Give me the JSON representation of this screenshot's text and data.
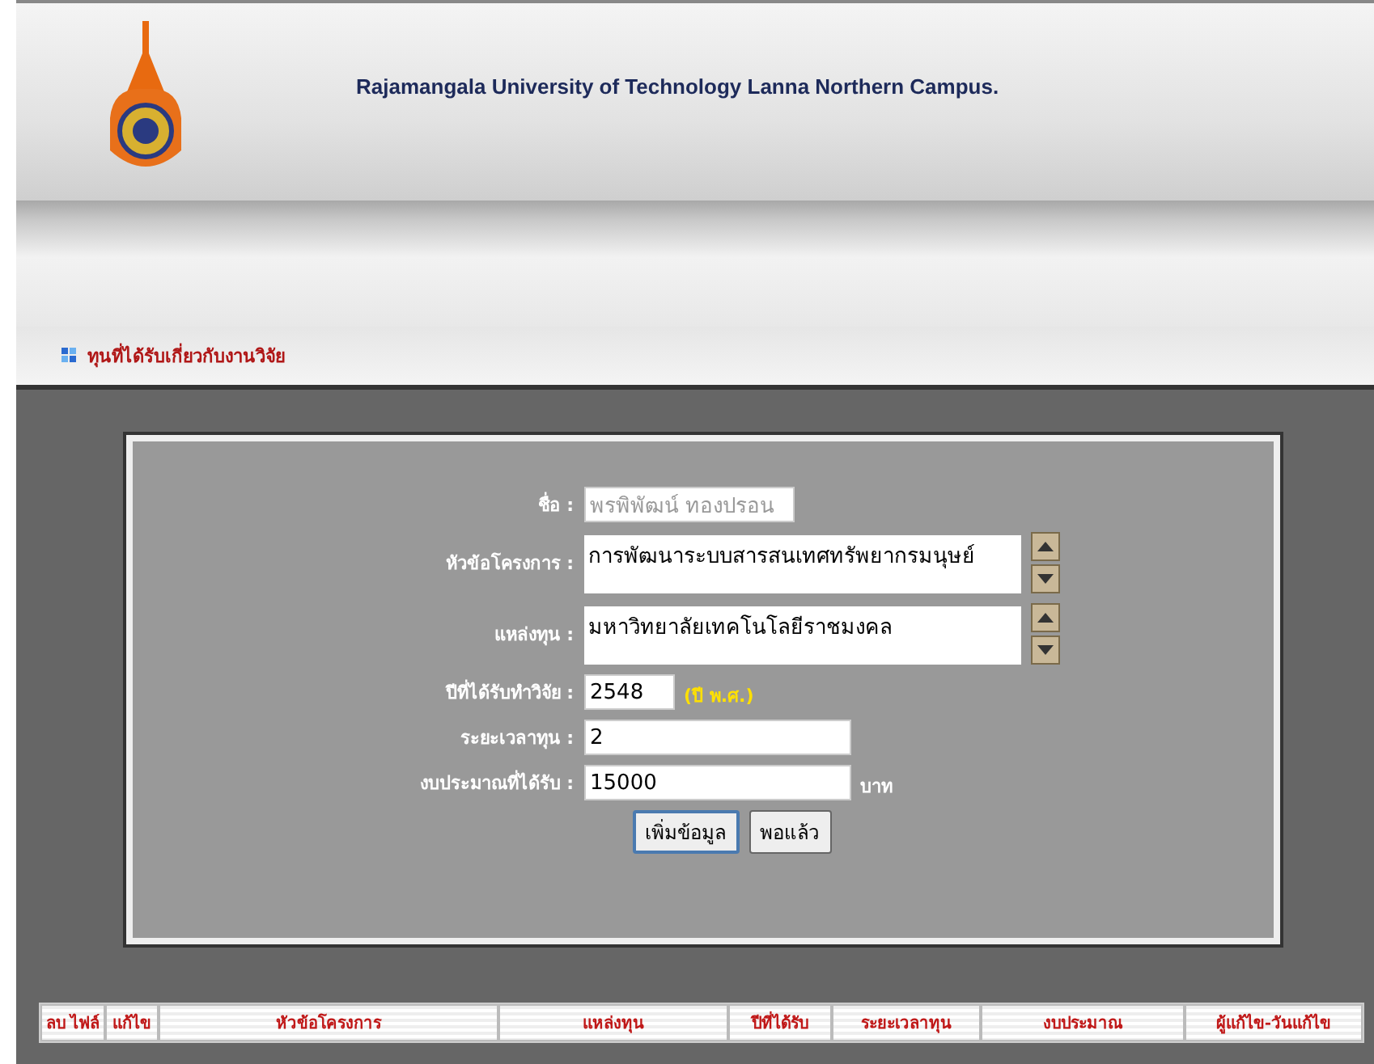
{
  "header": {
    "title": "Rajamangala University of Technology Lanna Northern Campus."
  },
  "section_title": "ทุนที่ได้รับเกี่ยวกับงานวิจัย",
  "form": {
    "fields": [
      {
        "kind": "input",
        "label": "ชื่อ :",
        "value": "พรพิพัฒน์ ทองปรอน",
        "disabled": true
      },
      {
        "kind": "textarea",
        "label": "หัวข้อโครงการ :",
        "value": "การพัฒนาระบบสารสนเทศทรัพยากรมนุษย์"
      },
      {
        "kind": "textarea",
        "label": "แหล่งทุน :",
        "value": "มหาวิทยาลัยเทคโนโลยีราชมงคล"
      },
      {
        "kind": "input",
        "label": "ปีที่ได้รับทำวิจัย :",
        "value": "2548",
        "disabled": false,
        "note": "(ปี พ.ศ.)"
      },
      {
        "kind": "input",
        "label": "ระยะเวลาทุน :",
        "value": "2",
        "disabled": false
      },
      {
        "kind": "input",
        "label": "งบประมาณที่ได้รับ :",
        "value": "15000",
        "disabled": false,
        "suffix": "บาท"
      }
    ],
    "buttons": [
      {
        "label": "เพิ่มข้อมูล",
        "focused": true
      },
      {
        "label": "พอแล้ว",
        "focused": false
      }
    ]
  },
  "table": {
    "columns": [
      "ลบ ไฟล์",
      "แก้ไข",
      "หัวข้อโครงการ",
      "แหล่งทุน",
      "ปีที่ได้รับ",
      "ระยะเวลาทุน",
      "งบประมาณ",
      "ผู้แก้ไข-วันแก้ไข"
    ]
  }
}
